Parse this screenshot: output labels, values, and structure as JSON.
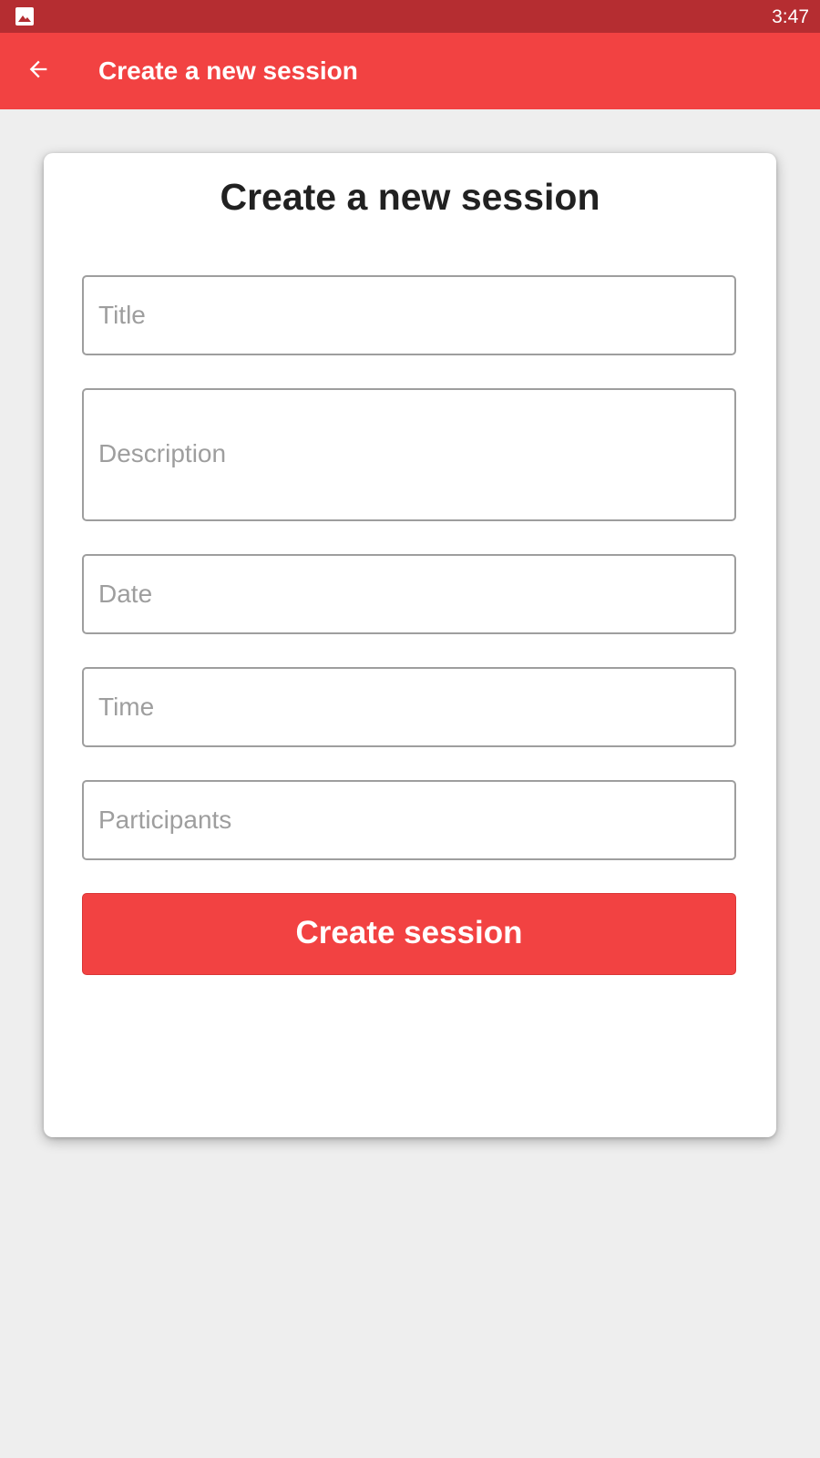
{
  "status_bar": {
    "time": "3:47",
    "notification_icon": "gallery-icon"
  },
  "app_bar": {
    "back_icon": "arrow-back-icon",
    "title": "Create a new session"
  },
  "form": {
    "heading": "Create a new session",
    "fields": {
      "title": {
        "placeholder": "Title",
        "value": ""
      },
      "description": {
        "placeholder": "Description",
        "value": ""
      },
      "date": {
        "placeholder": "Date",
        "value": ""
      },
      "time": {
        "placeholder": "Time",
        "value": ""
      },
      "participants": {
        "placeholder": "Participants",
        "value": ""
      }
    },
    "submit_label": "Create session"
  },
  "colors": {
    "status_bar": "#b52d31",
    "app_bar": "#f24242",
    "primary_button": "#f24242",
    "background": "#eeeeee"
  }
}
